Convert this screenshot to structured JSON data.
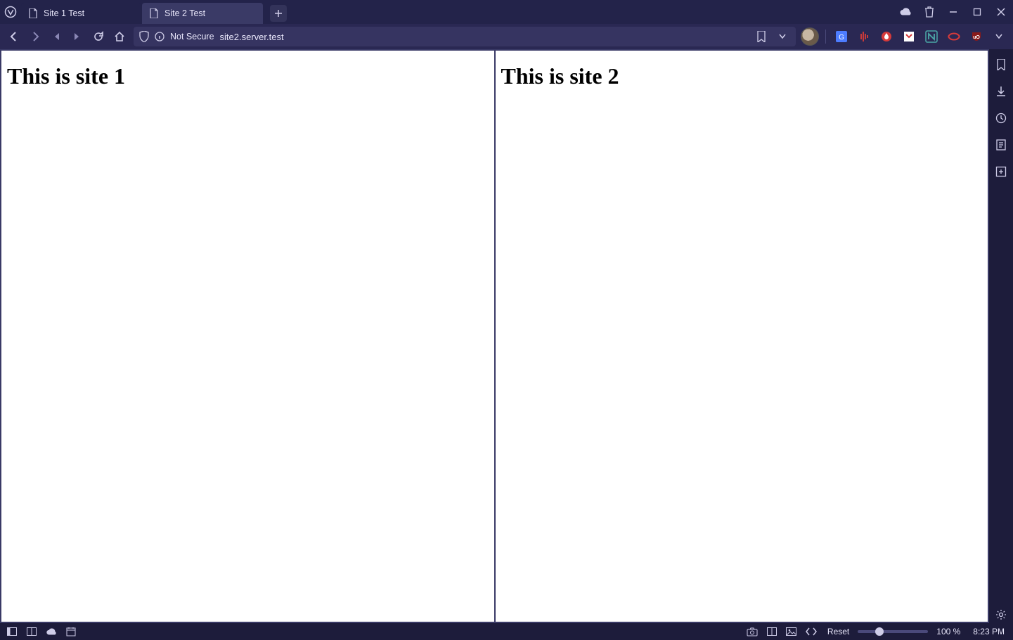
{
  "tabs": [
    {
      "title": "Site 1 Test",
      "active": false
    },
    {
      "title": "Site 2 Test",
      "active": true
    }
  ],
  "address": {
    "not_secure_label": "Not Secure",
    "url": "site2.server.test"
  },
  "content": {
    "left_heading": "This is site 1",
    "right_heading": "This is site 2"
  },
  "status": {
    "reset_label": "Reset",
    "zoom_label": "100 %",
    "clock": "8:23 PM"
  }
}
